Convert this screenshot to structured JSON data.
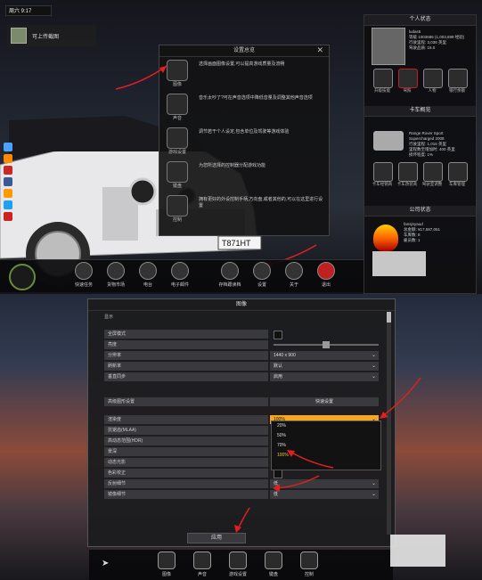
{
  "top": {
    "clock": "周六 9:17",
    "notice": "可上传截图",
    "settings": {
      "title": "设置总览",
      "rows": [
        {
          "label": "图像",
          "desc": "选择画面图像设置,可以提高游戏质量及流畅"
        },
        {
          "label": "声音",
          "desc": "音乐太吵了?可在声音选项中降低音量及调整其他声音选项"
        },
        {
          "label": "游戏设置",
          "desc": "调节若干个人设定,包含单位及驾驶等游戏体验"
        },
        {
          "label": "键盘",
          "desc": "为您所选择的控制器分配游戏功能"
        },
        {
          "label": "控制",
          "desc": "拥有更好的外设控制手柄,方向盘,或者其他的,可以在这里进行设置"
        }
      ]
    },
    "toolbar": [
      {
        "label": "快速任务"
      },
      {
        "label": "货物市场"
      },
      {
        "label": "电台"
      },
      {
        "label": "电子邮件"
      },
      {
        "label": "存档跟读档"
      },
      {
        "label": "设置"
      },
      {
        "label": "关于"
      },
      {
        "label": "退出"
      }
    ],
    "plate": "T871HT",
    "profile": {
      "title": "个人状态",
      "name": "ludas5",
      "lines": [
        "等级 1003686 (1,003,699 经验)",
        "行驶里程: 3,036 英里",
        "驾驶品质: 16.0"
      ],
      "buttons": [
        "升级技能",
        "驾照",
        "人物",
        "银行余额"
      ]
    },
    "truck": {
      "title": "卡车概览",
      "lines": [
        "Range Rover Sport",
        "Supercharged 2008",
        "行驶里程: 1,016 英里",
        "里程数至增加时: 400 英里",
        "损坏程度: 1%"
      ],
      "buttons": [
        "卡车经销商",
        "卡车改装商",
        "驾驶室调整",
        "车库管理"
      ]
    },
    "company": {
      "title": "公司状态",
      "lines": [
        "fansjnyaud",
        "总金额: ¥17,587,051",
        "车库数: 8",
        "雇员数: 1"
      ]
    }
  },
  "graphics": {
    "title": "图像",
    "sub": "显示",
    "rows": [
      {
        "label": "全屏模式",
        "value": "",
        "type": "check"
      },
      {
        "label": "亮度",
        "value": "",
        "type": "slider"
      },
      {
        "label": "分辨率",
        "value": "1440 x 900",
        "type": "select"
      },
      {
        "label": "刷新率",
        "value": "默认",
        "type": "select"
      },
      {
        "label": "垂直同步",
        "value": "启用",
        "type": "select"
      }
    ],
    "adv_label": "高级图形设置",
    "quick_label": "快速设置",
    "rows2": [
      {
        "label": "渲染度",
        "value": "100%"
      },
      {
        "label": "抗锯齿(MLAA)",
        "value": ""
      },
      {
        "label": "高动态范围(HDR)",
        "value": ""
      },
      {
        "label": "景深",
        "value": ""
      },
      {
        "label": "动态光影",
        "value": ""
      },
      {
        "label": "色彩校正",
        "value": ""
      },
      {
        "label": "反射细节",
        "value": "低"
      },
      {
        "label": "镜像细节",
        "value": "低"
      }
    ],
    "dropdown": [
      "20%",
      "50%",
      "70%",
      "100%"
    ],
    "apply": "应用"
  },
  "bottombar": [
    {
      "label": "图像"
    },
    {
      "label": "声音"
    },
    {
      "label": "游戏设置"
    },
    {
      "label": "键盘"
    },
    {
      "label": "控制"
    }
  ],
  "colors": {
    "accent": "#f5a623",
    "arrow": "#e02020"
  }
}
